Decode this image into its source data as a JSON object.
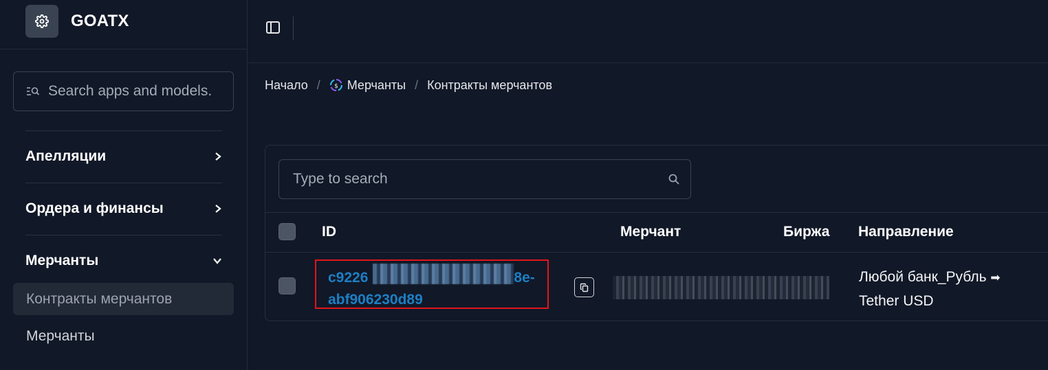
{
  "brand": {
    "name": "GOATX",
    "logo_icon": "gear-icon"
  },
  "sidebar": {
    "search_placeholder": "Search apps and models.",
    "groups": [
      {
        "label": "Апелляции",
        "icon": "chevron-right-icon",
        "expanded": false
      },
      {
        "label": "Ордера и финансы",
        "icon": "chevron-right-icon",
        "expanded": false
      },
      {
        "label": "Мерчанты",
        "icon": "chevron-down-icon",
        "expanded": true
      }
    ],
    "sub_items": [
      {
        "label": "Контракты мерчантов",
        "active": true
      },
      {
        "label": "Мерчанты",
        "active": false
      }
    ]
  },
  "topbar": {
    "toggle_icon": "sidebar-toggle-icon"
  },
  "breadcrumb": [
    {
      "label": "Начало"
    },
    {
      "label": "Мерчанты",
      "icon": "merchant-coin-icon"
    },
    {
      "label": "Контракты мерчантов"
    }
  ],
  "table": {
    "search_placeholder": "Type to search",
    "columns": {
      "id": "ID",
      "merchant": "Мерчант",
      "exchange": "Биржа",
      "direction": "Направление"
    },
    "rows": [
      {
        "id": "c9226  8e-abf906230d89",
        "id_visible_start": "c9226",
        "id_visible_mid": "8e-",
        "id_visible_end": "abf906230d89",
        "merchant": "",
        "exchange": "",
        "direction_from": "Любой банк_Рубль",
        "direction_to": "Tether USD",
        "direction_arrow": "➡",
        "highlighted": true
      }
    ]
  },
  "colors": {
    "background": "#111827",
    "link": "#1c7fc4",
    "highlight_border": "#e0161b"
  }
}
